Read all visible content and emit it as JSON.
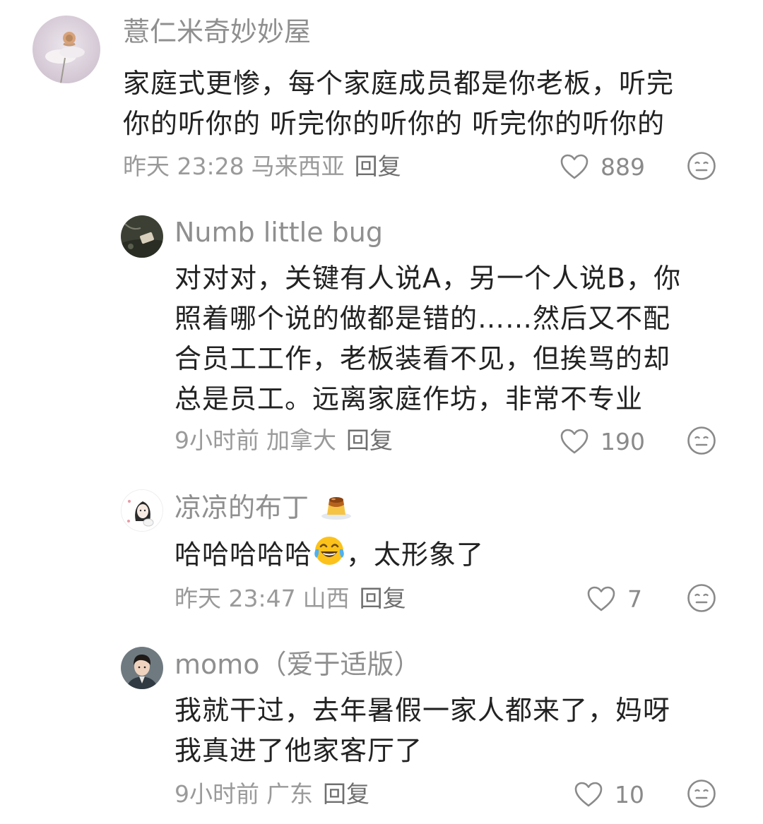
{
  "comments": [
    {
      "username": "薏仁米奇妙妙屋",
      "lines": [
        "家庭式更惨，每个家庭成员都是你老板，听完",
        "你的听你的 听完你的听你的 听完你的听你的"
      ],
      "time": "昨天 23:28",
      "location": "马来西亚",
      "reply": "回复",
      "likes": "889"
    },
    {
      "username": "Numb little bug",
      "lines": [
        "对对对，关键有人说A，另一个人说B，你",
        "照着哪个说的做都是错的……然后又不配",
        "合员工工作，老板装看不见，但挨骂的却",
        "总是员工。远离家庭作坊，非常不专业"
      ],
      "time": "9小时前",
      "location": "加拿大",
      "reply": "回复",
      "likes": "190"
    },
    {
      "username": "凉凉的布丁",
      "username_emoji": "pudding-emoji",
      "text_before_emoji": "哈哈哈哈哈",
      "text_emoji": "laughing-tears-emoji",
      "text_after_emoji": "，太形象了",
      "time": "昨天 23:47",
      "location": "山西",
      "reply": "回复",
      "likes": "7"
    },
    {
      "username": "momo（爱于适版）",
      "lines": [
        "我就干过，去年暑假一家人都来了，妈呀",
        "我真进了他家客厅了"
      ],
      "time": "9小时前",
      "location": "广东",
      "reply": "回复",
      "likes": "10"
    }
  ],
  "colors": {
    "username": "#8f8f8f",
    "body": "#222222",
    "meta": "#9a9a9a",
    "icon": "#8a8a8a"
  }
}
